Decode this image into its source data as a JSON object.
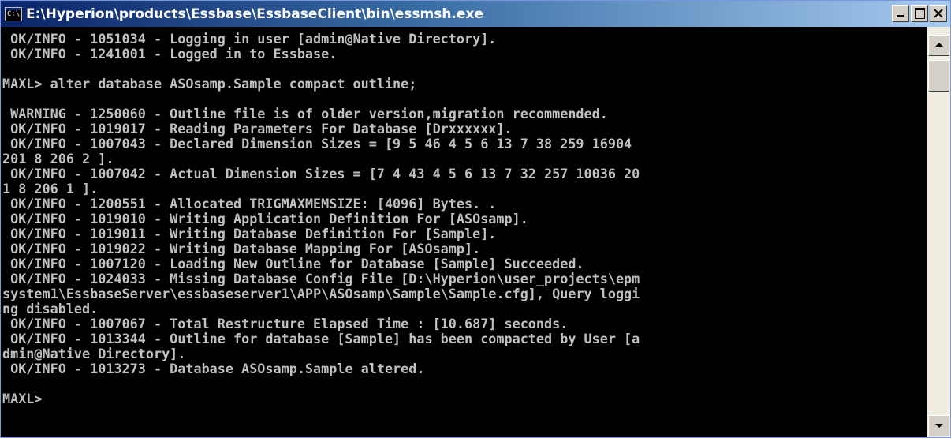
{
  "window": {
    "title": "E:\\Hyperion\\products\\Essbase\\EssbaseClient\\bin\\essmsh.exe",
    "icon_label": "C:\\"
  },
  "console": {
    "lines": [
      " OK/INFO - 1051034 - Logging in user [admin@Native Directory].",
      " OK/INFO - 1241001 - Logged in to Essbase.",
      "",
      "MAXL> alter database ASOsamp.Sample compact outline;",
      "",
      " WARNING - 1250060 - Outline file is of older version,migration recommended.",
      " OK/INFO - 1019017 - Reading Parameters For Database [Drxxxxxx].",
      " OK/INFO - 1007043 - Declared Dimension Sizes = [9 5 46 4 5 6 13 7 38 259 16904",
      "201 8 206 2 ].",
      " OK/INFO - 1007042 - Actual Dimension Sizes = [7 4 43 4 5 6 13 7 32 257 10036 20",
      "1 8 206 1 ].",
      " OK/INFO - 1200551 - Allocated TRIGMAXMEMSIZE: [4096] Bytes. .",
      " OK/INFO - 1019010 - Writing Application Definition For [ASOsamp].",
      " OK/INFO - 1019011 - Writing Database Definition For [Sample].",
      " OK/INFO - 1019022 - Writing Database Mapping For [ASOsamp].",
      " OK/INFO - 1007120 - Loading New Outline for Database [Sample] Succeeded.",
      " OK/INFO - 1024033 - Missing Database Config File [D:\\Hyperion\\user_projects\\epm",
      "system1\\EssbaseServer\\essbaseserver1\\APP\\ASOsamp\\Sample\\Sample.cfg], Query loggi",
      "ng disabled.",
      " OK/INFO - 1007067 - Total Restructure Elapsed Time : [10.687] seconds.",
      " OK/INFO - 1013344 - Outline for database [Sample] has been compacted by User [a",
      "dmin@Native Directory].",
      " OK/INFO - 1013273 - Database ASOsamp.Sample altered.",
      "",
      "MAXL>"
    ]
  },
  "colors": {
    "console_bg": "#000000",
    "console_text": "#c0c0c0",
    "titlebar_start": "#0a246a",
    "titlebar_end": "#a6caf0"
  }
}
